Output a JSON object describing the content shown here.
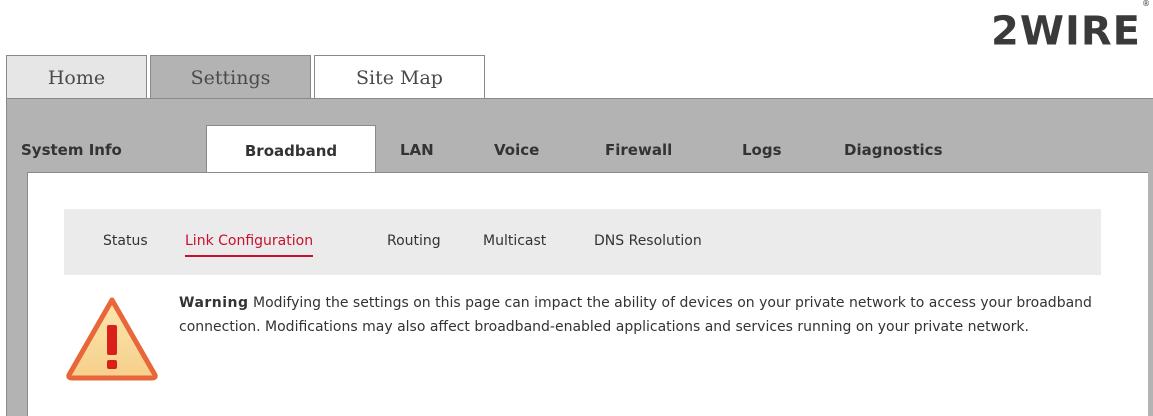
{
  "logo": {
    "text": "2WIRE",
    "reg": "®"
  },
  "top_tabs": [
    {
      "label": "Home"
    },
    {
      "label": "Settings"
    },
    {
      "label": "Site Map"
    }
  ],
  "sub_tabs": [
    {
      "label": "System Info"
    },
    {
      "label": "Broadband"
    },
    {
      "label": "LAN"
    },
    {
      "label": "Voice"
    },
    {
      "label": "Firewall"
    },
    {
      "label": "Logs"
    },
    {
      "label": "Diagnostics"
    }
  ],
  "nav3": [
    {
      "label": "Status"
    },
    {
      "label": "Link Configuration"
    },
    {
      "label": "Routing"
    },
    {
      "label": "Multicast"
    },
    {
      "label": "DNS Resolution"
    }
  ],
  "warning": {
    "heading": "Warning",
    "message": "Modifying the settings on this page can impact the ability of devices on your private network to access your broadband connection. Modifications may also affect broadband-enabled applications and services running on your private network."
  },
  "colors": {
    "active_accent": "#c8102e",
    "warning_icon": "#e8663a",
    "tab_selected": "#b3b3b3"
  }
}
